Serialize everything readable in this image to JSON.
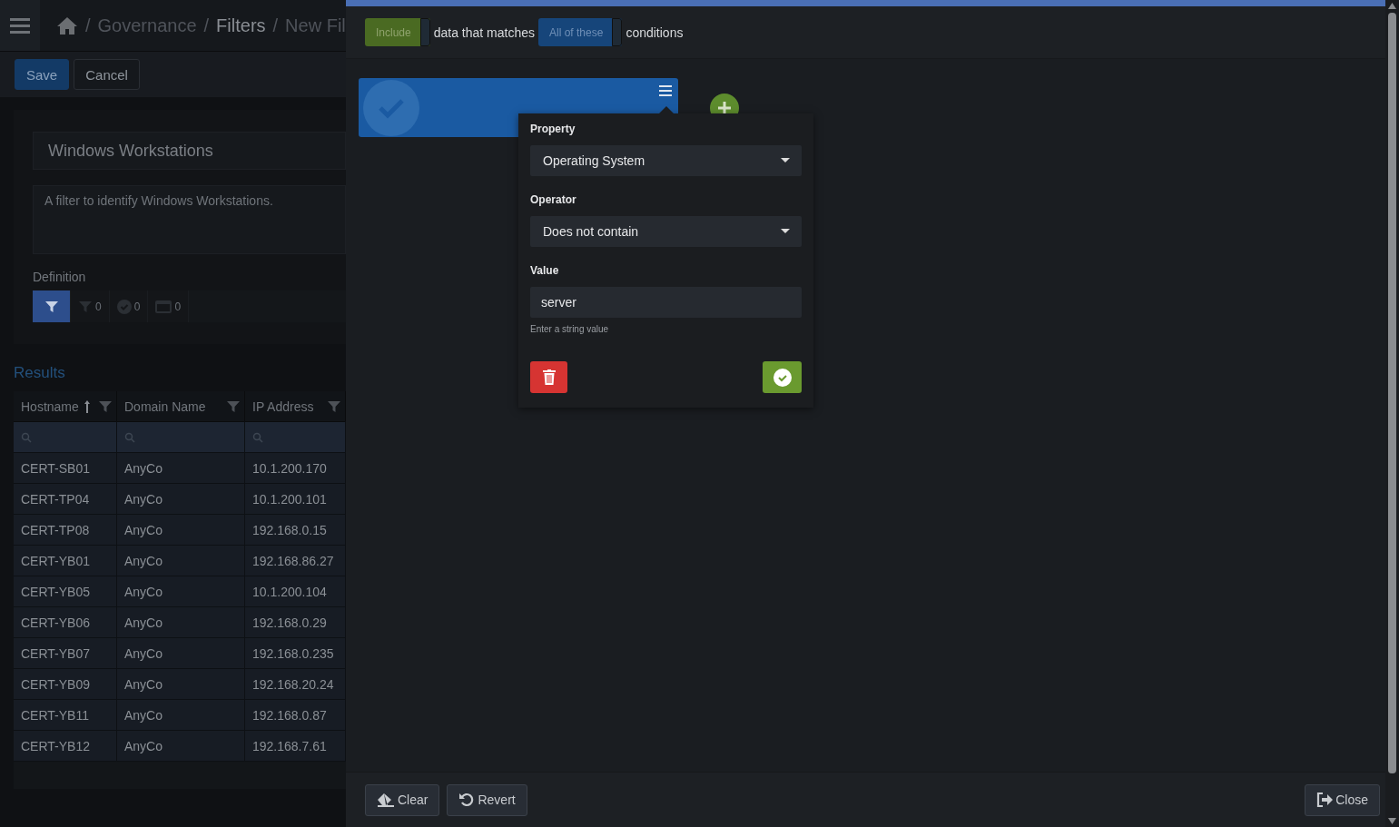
{
  "breadcrumb": [
    {
      "kind": "separator",
      "text": "/"
    },
    {
      "kind": "link",
      "text": "Governance",
      "selected": false
    },
    {
      "kind": "separator",
      "text": "/"
    },
    {
      "kind": "link",
      "text": "Filters",
      "selected": true
    },
    {
      "kind": "separator",
      "text": "/"
    },
    {
      "kind": "link",
      "text": "New Fil",
      "selected": false
    }
  ],
  "toolbar": {
    "save": "Save",
    "cancel": "Cancel"
  },
  "filter": {
    "name": "Windows Workstations",
    "description": "A filter to identify Windows Workstations."
  },
  "definition": {
    "label": "Definition",
    "tabs": [
      {
        "kind": "funnel",
        "selected": true
      },
      {
        "kind": "funnel",
        "count": "0",
        "selected": false
      },
      {
        "kind": "check",
        "count": "0",
        "selected": false
      },
      {
        "kind": "calendar",
        "count": "0",
        "selected": false
      }
    ]
  },
  "results": {
    "title": "Results",
    "columns": [
      {
        "label": "Hostname",
        "sorted": true
      },
      {
        "label": "Domain Name",
        "sorted": false
      },
      {
        "label": "IP Address",
        "sorted": false
      }
    ],
    "rows": [
      [
        "CERT-SB01",
        "AnyCo",
        "10.1.200.170"
      ],
      [
        "CERT-TP04",
        "AnyCo",
        "10.1.200.101"
      ],
      [
        "CERT-TP08",
        "AnyCo",
        "192.168.0.15"
      ],
      [
        "CERT-YB01",
        "AnyCo",
        "192.168.86.27"
      ],
      [
        "CERT-YB05",
        "AnyCo",
        "10.1.200.104"
      ],
      [
        "CERT-YB06",
        "AnyCo",
        "192.168.0.29"
      ],
      [
        "CERT-YB07",
        "AnyCo",
        "192.168.0.235"
      ],
      [
        "CERT-YB09",
        "AnyCo",
        "192.168.20.24"
      ],
      [
        "CERT-YB11",
        "AnyCo",
        "192.168.0.87"
      ],
      [
        "CERT-YB12",
        "AnyCo",
        "192.168.7.61"
      ]
    ]
  },
  "editor": {
    "mode": "Include",
    "text_1": "data that matches",
    "match": "All of these",
    "text_2": "conditions",
    "condition": {
      "checked": true
    },
    "popover": {
      "property_label": "Property",
      "property": "Operating System",
      "operator_label": "Operator",
      "operator": "Does not contain",
      "value_label": "Value",
      "value": "server",
      "hint": "Enter a string value"
    },
    "footer": {
      "clear": "Clear",
      "revert": "Revert",
      "close": "Close"
    }
  }
}
